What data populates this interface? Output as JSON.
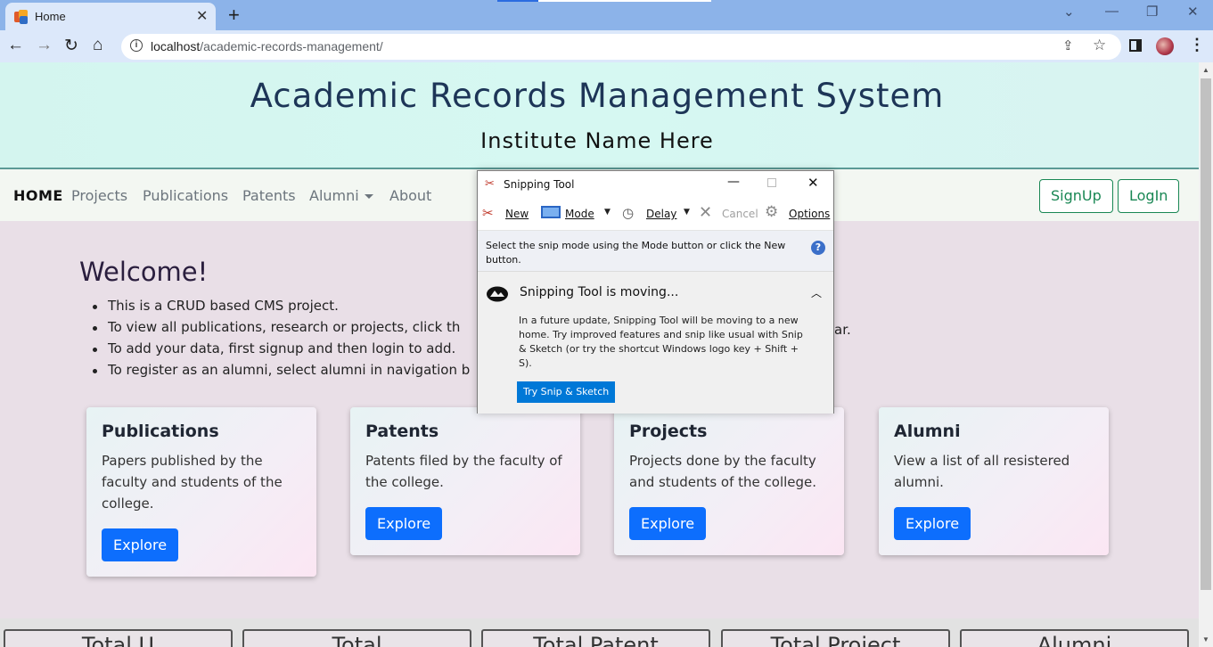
{
  "browser": {
    "tab_title": "Home",
    "url_host": "localhost",
    "url_path": "/academic-records-management/"
  },
  "header": {
    "title": "Academic Records Management System",
    "subtitle": "Institute Name Here"
  },
  "nav": {
    "items": [
      "HOME",
      "Projects",
      "Publications",
      "Patents",
      "Alumni",
      "About"
    ],
    "signup_label": "SignUp",
    "login_label": "LogIn"
  },
  "welcome": {
    "heading": "Welcome!",
    "bullets": [
      "This is a CRUD based CMS project.",
      "To view all publications, research or projects, click th",
      "To add your data, first signup and then login to add.",
      "To register as an alumni, select alumni in navigation b"
    ],
    "bullet_tail": "ar."
  },
  "cards": [
    {
      "title": "Publications",
      "text": "Papers published by the faculty and students of the college.",
      "button": "Explore"
    },
    {
      "title": "Patents",
      "text": "Patents filed by the faculty of the college.",
      "button": "Explore"
    },
    {
      "title": "Projects",
      "text": "Projects done by the faculty and students of the college.",
      "button": "Explore"
    },
    {
      "title": "Alumni",
      "text": "View a list of all resistered alumni.",
      "button": "Explore"
    }
  ],
  "stats": [
    "Total U",
    "Total",
    "Total Patent",
    "Total Project",
    "Alumni"
  ],
  "snipping_tool": {
    "title": "Snipping Tool",
    "new_label": "New",
    "mode_label": "Mode",
    "delay_label": "Delay",
    "cancel_label": "Cancel",
    "options_label": "Options",
    "instruction": "Select the snip mode using the Mode button or click the New button.",
    "notice_title": "Snipping Tool is moving...",
    "notice_body": "In a future update, Snipping Tool will be moving to a new home. Try improved features and snip like usual with Snip & Sketch (or try the shortcut Windows logo key + Shift + S).",
    "try_button": "Try Snip & Sketch"
  },
  "colors": {
    "accent": "#0d6efd",
    "success": "#198754",
    "title": "#1d3557",
    "snip_button": "#0078d7"
  }
}
